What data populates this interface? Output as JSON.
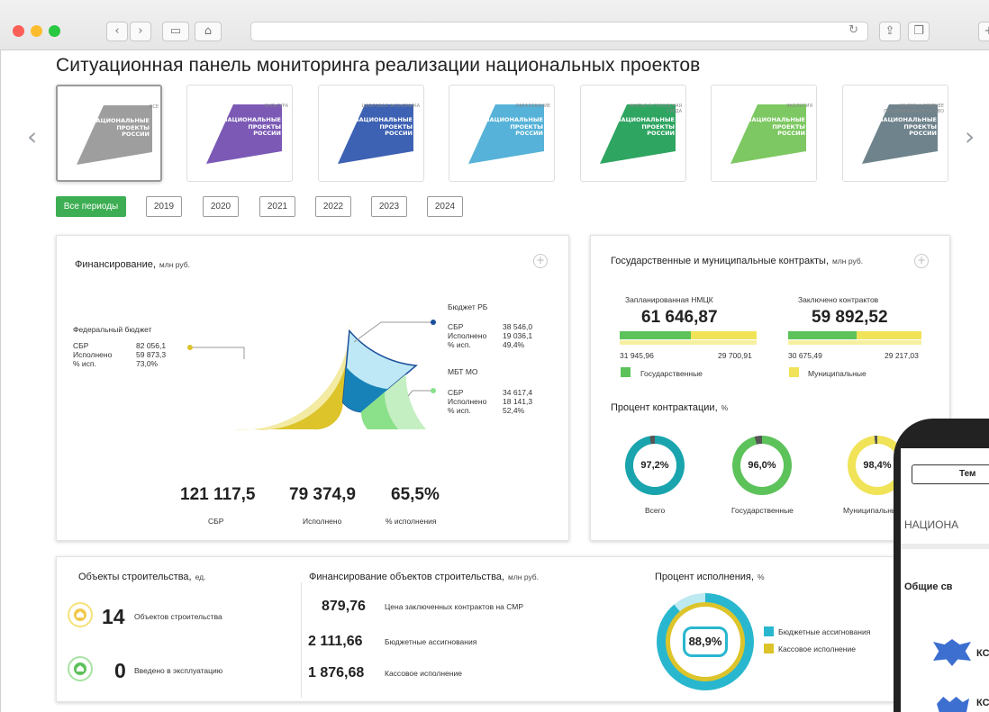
{
  "page": {
    "title": "Ситуационная панель мониторинга реализации национальных проектов"
  },
  "colors": {
    "accent_green": "#3dae53",
    "gov_green": "#5cc25a",
    "mun_yellow": "#f0e357",
    "teal": "#1aa4ad",
    "yellow_dark": "#dcc42a"
  },
  "nav": {
    "prev_icon": "chevron-left-icon",
    "next_icon": "chevron-right-icon",
    "prev_glyph": "‹",
    "next_glyph": "›"
  },
  "projects": [
    {
      "tag": "все",
      "l1": "НАЦИОНАЛЬНЫЕ",
      "l2": "ПРОЕКТЫ",
      "l3": "РОССИИ",
      "color": "#9e9e9e"
    },
    {
      "tag": "культура",
      "l1": "НАЦИОНАЛЬНЫЕ",
      "l2": "ПРОЕКТЫ",
      "l3": "РОССИИ",
      "color": "#7b59b5"
    },
    {
      "tag": "цифровая экономика",
      "l1": "НАЦИОНАЛЬНЫЕ",
      "l2": "ПРОЕКТЫ",
      "l3": "РОССИИ",
      "color": "#3d61b3"
    },
    {
      "tag": "образование",
      "l1": "НАЦИОНАЛЬНЫЕ",
      "l2": "ПРОЕКТЫ",
      "l3": "РОССИИ",
      "color": "#56b2d8"
    },
    {
      "tag": "жилье и городская среда",
      "l1": "НАЦИОНАЛЬНЫЕ",
      "l2": "ПРОЕКТЫ",
      "l3": "РОССИИ",
      "color": "#2fa562"
    },
    {
      "tag": "экология",
      "l1": "НАЦИОНАЛЬНЫЕ",
      "l2": "ПРОЕКТЫ",
      "l3": "РОССИИ",
      "color": "#7dc862"
    },
    {
      "tag": "малое и среднее предпринимательство",
      "l1": "НАЦИОНАЛЬНЫЕ",
      "l2": "ПРОЕКТЫ",
      "l3": "РОССИИ",
      "color": "#6f838c"
    }
  ],
  "periods": [
    "Все периоды",
    "2019",
    "2020",
    "2021",
    "2022",
    "2023",
    "2024"
  ],
  "financing": {
    "title": "Финансирование,",
    "unit": "млн руб.",
    "federal": {
      "label": "Федеральный бюджет",
      "k1": "СБР",
      "v1": "82 056,1",
      "k2": "Исполнено",
      "v2": "59 873,3",
      "k3": "% исп.",
      "v3": "73,0%"
    },
    "rb": {
      "label": "Бюджет РБ",
      "k1": "СБР",
      "v1": "38 546,0",
      "k2": "Исполнено",
      "v2": "19 036,1",
      "k3": "% исп.",
      "v3": "49,4%"
    },
    "mbt": {
      "label": "МБТ МО",
      "k1": "СБР",
      "v1": "34 617,4",
      "k2": "Исполнено",
      "v2": "18 141,3",
      "k3": "% исп.",
      "v3": "52,4%"
    },
    "totals": [
      {
        "value": "121 117,5",
        "label": "СБР"
      },
      {
        "value": "79 374,9",
        "label": "Исполнено"
      },
      {
        "value": "65,5%",
        "label": "% исполнения"
      }
    ]
  },
  "contracts": {
    "title": "Государственные и муниципальные контракты,",
    "unit": "млн руб.",
    "planned": {
      "label": "Запланированная НМЦК",
      "value": "61 646,87",
      "gov": "31 945,96",
      "mun": "29 700,91",
      "gov_share": 0.518
    },
    "concluded": {
      "label": "Заключено контрактов",
      "value": "59 892,52",
      "gov": "30 675,49",
      "mun": "29 217,03",
      "gov_share": 0.512
    },
    "legend_gov": "Государственные",
    "legend_mun": "Муниципальные",
    "percent_title": "Процент контрактации,",
    "percent_unit": "%",
    "donuts": [
      {
        "value": "97,2%",
        "label": "Всего",
        "color": "#1aa4ad",
        "pct": 97.2
      },
      {
        "value": "96,0%",
        "label": "Государственные",
        "color": "#5cc25a",
        "pct": 96.0
      },
      {
        "value": "98,4%",
        "label": "Муниципальные",
        "color": "#f0e357",
        "pct": 98.4
      }
    ]
  },
  "objects": {
    "title": "Объекты строительства,",
    "unit": "ед.",
    "count_value": "14",
    "count_label": "Объектов строительства",
    "commissioned_value": "0",
    "commissioned_label": "Введено в эксплуатацию",
    "count_icon": "house-icon",
    "commissioned_icon": "house-check-icon"
  },
  "objects_fin": {
    "title": "Финансирование объектов строительства,",
    "unit": "млн руб.",
    "rows": [
      {
        "value": "879,76",
        "label": "Цена заключенных контрактов на СМР"
      },
      {
        "value": "2 111,66",
        "label": "Бюджетные ассигнования"
      },
      {
        "value": "1 876,68",
        "label": "Кассовое исполнение"
      }
    ]
  },
  "execution": {
    "title": "Процент исполнения,",
    "unit": "%",
    "value": "88,9%",
    "pct": 88.9,
    "legend": [
      {
        "label": "Бюджетные ассигнования",
        "color": "#29b7cf"
      },
      {
        "label": "Кассовое исполнение",
        "color": "#dcc42a"
      }
    ]
  },
  "phone": {
    "tab": "Тем",
    "header": "НАЦИОНА",
    "section": "Общие св",
    "row1": "КС",
    "row2": "КС"
  }
}
